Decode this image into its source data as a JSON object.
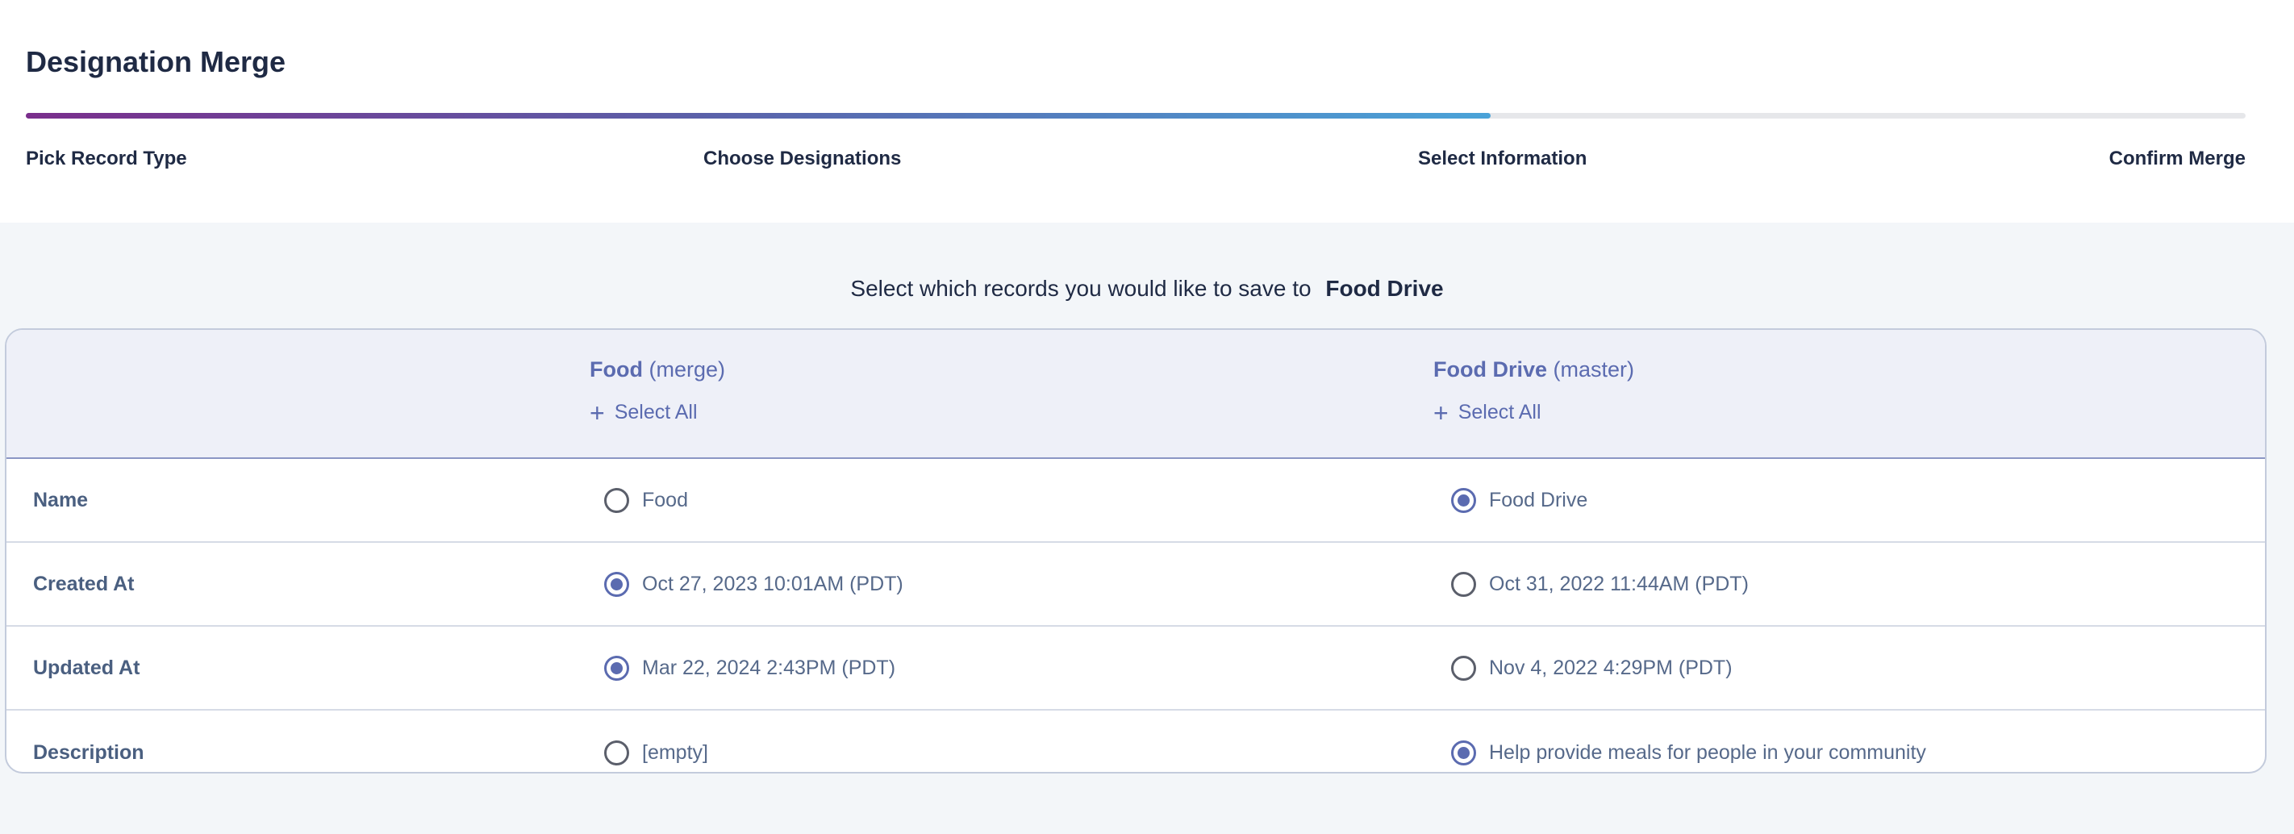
{
  "header": {
    "title": "Designation Merge",
    "progress_fraction": 0.66,
    "steps": [
      {
        "label": "Pick Record Type"
      },
      {
        "label": "Choose Designations"
      },
      {
        "label": "Select Information"
      },
      {
        "label": "Confirm Merge"
      }
    ]
  },
  "main": {
    "instruction_text": "Select which records you would like to save to",
    "instruction_target": "Food Drive",
    "columns": {
      "merge": {
        "name": "Food",
        "role": "(merge)",
        "select_all": "Select All"
      },
      "master": {
        "name": "Food Drive",
        "role": "(master)",
        "select_all": "Select All"
      }
    },
    "rows": [
      {
        "label": "Name",
        "merge_value": "Food",
        "master_value": "Food Drive",
        "selected": "master"
      },
      {
        "label": "Created At",
        "merge_value": "Oct 27, 2023 10:01AM (PDT)",
        "master_value": "Oct 31, 2022 11:44AM (PDT)",
        "selected": "merge"
      },
      {
        "label": "Updated At",
        "merge_value": "Mar 22, 2024 2:43PM (PDT)",
        "master_value": "Nov 4, 2022 4:29PM (PDT)",
        "selected": "merge"
      },
      {
        "label": "Description",
        "merge_value": "[empty]",
        "master_value": "Help provide meals for people in your community",
        "selected": "master"
      }
    ]
  },
  "colors": {
    "accent": "#5b6bb0",
    "progress_start": "#7a2e8c",
    "progress_end": "#4aa3d8",
    "background": "#f3f6f9"
  },
  "icons": {
    "plus": "plus-icon",
    "radio_selected": "radio-selected",
    "radio_unselected": "radio-unselected"
  }
}
